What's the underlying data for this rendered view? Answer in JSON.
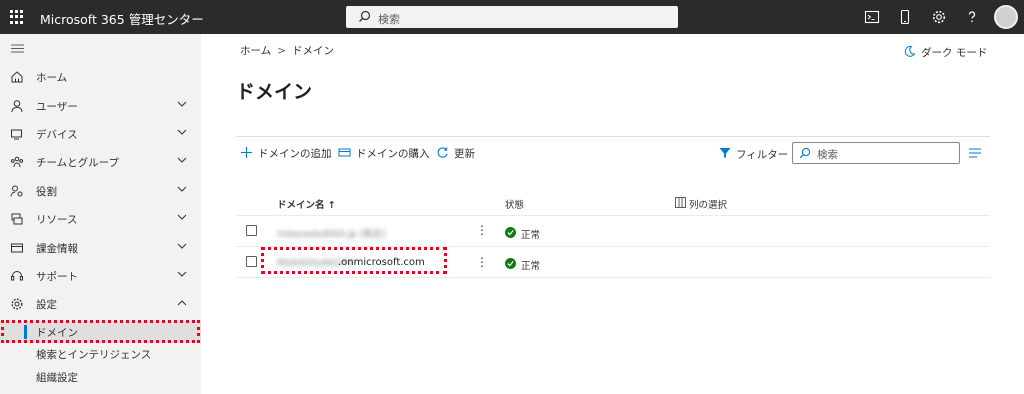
{
  "header": {
    "app_title": "Microsoft 365 管理センター",
    "search_placeholder": "検索",
    "icons": [
      "waffle-icon",
      "terminal-icon",
      "mobile-icon",
      "gear-icon",
      "help-icon",
      "avatar"
    ]
  },
  "sidebar": {
    "items": [
      {
        "label": "ホーム",
        "icon": "home-icon"
      },
      {
        "label": "ユーザー",
        "icon": "user-icon"
      },
      {
        "label": "デバイス",
        "icon": "device-icon"
      },
      {
        "label": "チームとグループ",
        "icon": "teams-icon"
      },
      {
        "label": "役割",
        "icon": "roles-icon"
      },
      {
        "label": "リソース",
        "icon": "resources-icon"
      },
      {
        "label": "課金情報",
        "icon": "billing-icon"
      },
      {
        "label": "サポート",
        "icon": "support-icon"
      },
      {
        "label": "設定",
        "icon": "settings-icon"
      }
    ],
    "sub_items": [
      {
        "label": "ドメイン",
        "active": true
      },
      {
        "label": "検索とインテリジェンス"
      },
      {
        "label": "組織設定"
      }
    ]
  },
  "main": {
    "breadcrumb": {
      "home": "ホーム",
      "current": "ドメイン",
      "separator": ">"
    },
    "dark_mode": "ダーク モード",
    "title": "ドメイン",
    "commands": {
      "add": "ドメインの追加",
      "buy": "ドメインの購入",
      "refresh": "更新"
    },
    "filter_label": "フィルター",
    "search_placeholder": "検索"
  },
  "table": {
    "headers": {
      "name": "ドメイン名 ↑",
      "status": "状態",
      "choose_columns": "列の選択"
    },
    "rows": [
      {
        "domain_redacted": "mdaoadsd000.jp (既定)",
        "domain_visible": "",
        "status": "正常"
      },
      {
        "domain_redacted": "M0A0D0yN0273",
        "domain_visible": ".onmicrosoft.com",
        "status": "正常"
      }
    ]
  },
  "colors": {
    "accent": "#0078d4",
    "status_ok": "#107c10",
    "highlight": "#e8001c",
    "topbar": "#2b2b2b",
    "sidebar": "#f3f2f1"
  }
}
